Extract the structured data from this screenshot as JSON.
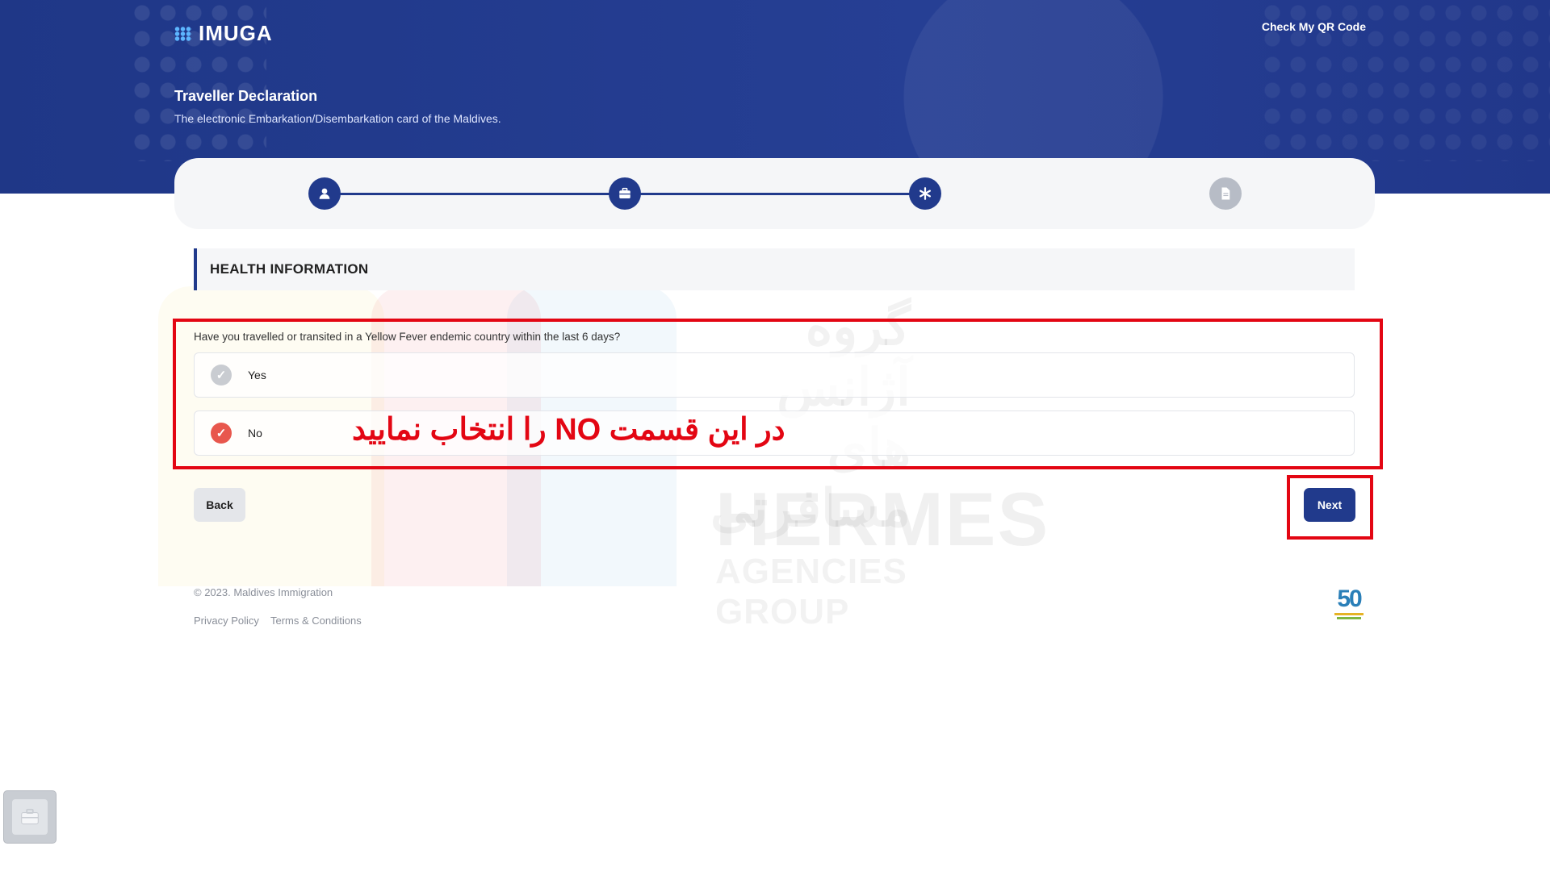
{
  "header": {
    "logo_text": "IMUGA",
    "qr_link": "Check My QR Code",
    "title": "Traveller Declaration",
    "subtitle": "The electronic Embarkation/Disembarkation card of the Maldives."
  },
  "stepper": {
    "steps": [
      {
        "icon": "user-icon",
        "state": "complete"
      },
      {
        "icon": "briefcase-icon",
        "state": "complete"
      },
      {
        "icon": "asterisk-icon",
        "state": "active"
      },
      {
        "icon": "document-icon",
        "state": "pending"
      }
    ]
  },
  "section": {
    "heading": "HEALTH INFORMATION",
    "question": "Have you travelled or transited in a Yellow Fever endemic country within the last 6 days?",
    "options": [
      {
        "label": "Yes",
        "selected": false
      },
      {
        "label": "No",
        "selected": true
      }
    ]
  },
  "annotation": {
    "text": "در این قسمت NO را انتخاب نمایید",
    "color": "#e30613"
  },
  "watermark": {
    "persian": "گروه آژانس های مسافرتی",
    "line1": "HERMES",
    "line2": "AGENCIES GROUP"
  },
  "actions": {
    "back_label": "Back",
    "next_label": "Next"
  },
  "footer": {
    "copyright": "© 2023. Maldives Immigration",
    "privacy": "Privacy Policy",
    "terms": "Terms & Conditions",
    "badge": "50"
  },
  "colors": {
    "brand_navy": "#213a8c",
    "selected_radio": "#e8574d",
    "annotation_red": "#e30613"
  }
}
